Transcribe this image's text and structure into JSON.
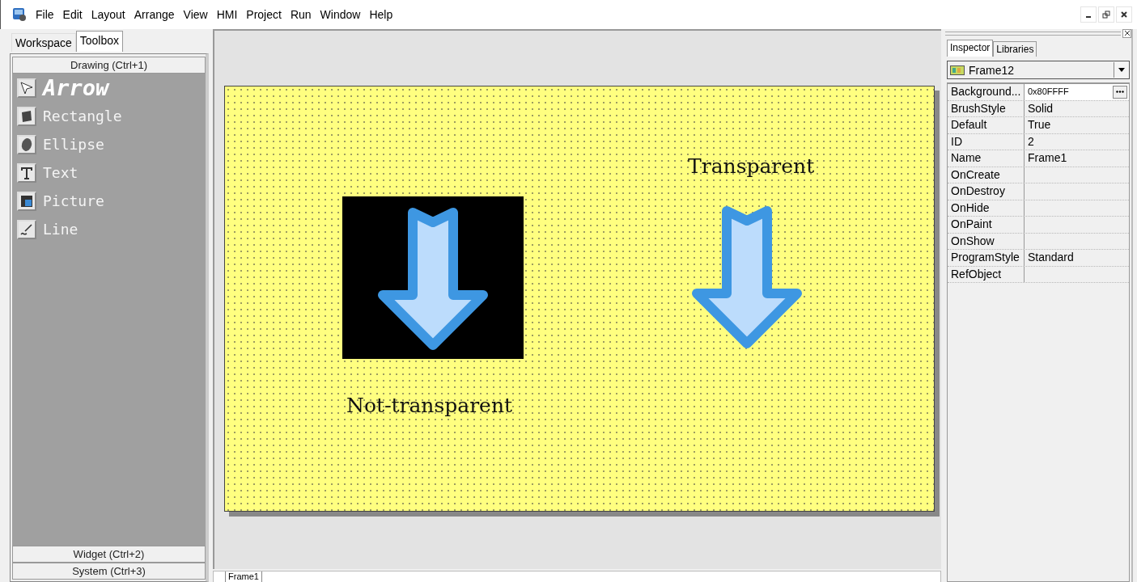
{
  "menu": [
    "File",
    "Edit",
    "Layout",
    "Arrange",
    "View",
    "HMI",
    "Project",
    "Run",
    "Window",
    "Help"
  ],
  "left_tabs": [
    {
      "label": "Workspace",
      "selected": false
    },
    {
      "label": "Toolbox",
      "selected": true
    }
  ],
  "toolbox": {
    "sections": [
      {
        "label": "Drawing (Ctrl+1)",
        "expanded": true,
        "tools": [
          {
            "kind": "arrow",
            "label": "Arrow",
            "selected": true
          },
          {
            "kind": "rectangle",
            "label": "Rectangle",
            "selected": false
          },
          {
            "kind": "ellipse",
            "label": "Ellipse",
            "selected": false
          },
          {
            "kind": "text",
            "label": "Text",
            "selected": false
          },
          {
            "kind": "picture",
            "label": "Picture",
            "selected": false
          },
          {
            "kind": "line",
            "label": "Line",
            "selected": false
          }
        ]
      },
      {
        "label": "Widget (Ctrl+2)",
        "expanded": false
      },
      {
        "label": "System (Ctrl+3)",
        "expanded": false
      }
    ]
  },
  "canvas": {
    "objects": [
      {
        "kind": "arrow",
        "transparent": false
      },
      {
        "kind": "label",
        "text": "Not-transparent"
      },
      {
        "kind": "label",
        "text": "Transparent"
      },
      {
        "kind": "arrow",
        "transparent": true
      }
    ]
  },
  "document_tabs": [
    {
      "label": "Frame1"
    }
  ],
  "inspector": {
    "tabs": [
      {
        "label": "Inspector",
        "selected": true
      },
      {
        "label": "Libraries",
        "selected": false
      }
    ],
    "object": "Frame12",
    "properties": [
      {
        "name": "Background...",
        "value": "0x80FFFF",
        "kind": "color"
      },
      {
        "name": "BrushStyle",
        "value": "Solid"
      },
      {
        "name": "Default",
        "value": "True"
      },
      {
        "name": "ID",
        "value": "2"
      },
      {
        "name": "Name",
        "value": "Frame1"
      },
      {
        "name": "OnCreate"
      },
      {
        "name": "OnDestroy"
      },
      {
        "name": "OnHide"
      },
      {
        "name": "OnPaint"
      },
      {
        "name": "OnShow"
      },
      {
        "name": "ProgramStyle",
        "value": "Standard"
      },
      {
        "name": "RefObject"
      }
    ]
  }
}
